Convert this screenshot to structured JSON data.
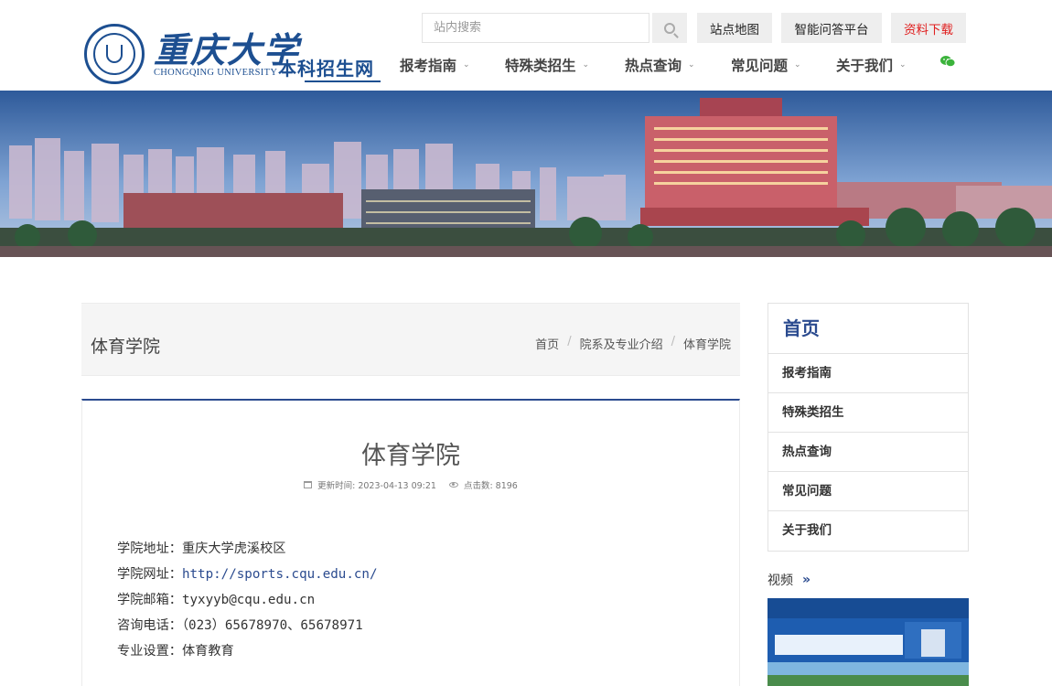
{
  "header": {
    "logo_cn": "重庆大学",
    "logo_en": "CHONGQING UNIVERSITY",
    "site_name": "本科招生网",
    "search_placeholder": "站内搜索",
    "top_buttons": {
      "sitemap": "站点地图",
      "qa": "智能问答平台",
      "download": "资料下载"
    },
    "download_color": "#e02020",
    "nav": [
      "报考指南",
      "特殊类招生",
      "热点查询",
      "常见问题",
      "关于我们"
    ]
  },
  "page": {
    "section_title": "体育学院",
    "breadcrumb": [
      "首页",
      "院系及专业介绍",
      "体育学院"
    ]
  },
  "article": {
    "title": "体育学院",
    "updated_label": "更新时间: 2023-04-13 09:21",
    "views_label": "点击数: 8196",
    "info": [
      {
        "label": "学院地址：",
        "value": "重庆大学虎溪校区"
      },
      {
        "label": "学院网址：",
        "value": "http://sports.cqu.edu.cn/"
      },
      {
        "label": "学院邮箱：",
        "value": "tyxyyb@cqu.edu.cn"
      },
      {
        "label": "咨询电话：",
        "value": "（023）65678970、65678971"
      },
      {
        "label": "专业设置：",
        "value": "体育教育"
      }
    ]
  },
  "sidebar": {
    "home": "首页",
    "items": [
      "报考指南",
      "特殊类招生",
      "热点查询",
      "常见问题",
      "关于我们"
    ],
    "video_label": "视频"
  },
  "colors": {
    "brand": "#1d4f91",
    "accent": "#2b4b8f"
  }
}
